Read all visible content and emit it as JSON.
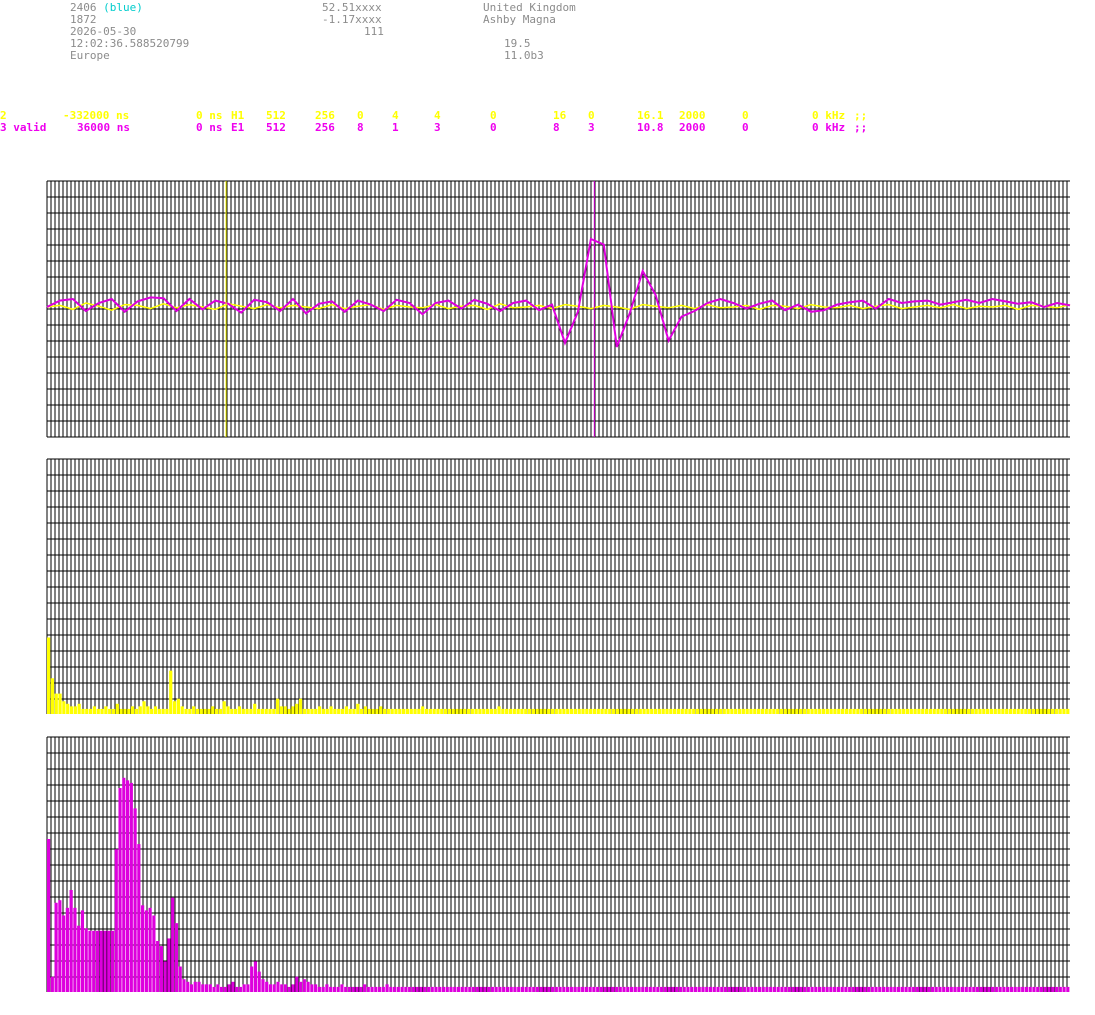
{
  "header": {
    "station_id": "2406",
    "station_color_label": "(blue)",
    "station_number": "1872",
    "date": "2026-05-30",
    "time": "12:02:36.588520799",
    "region": "Europe",
    "latitude": "52.51xxxx",
    "longitude": "-1.17xxxx",
    "altitude": "111",
    "country": "United Kingdom",
    "place": "Ashby Magna",
    "value_a": "19.5",
    "value_b": "11.0b3"
  },
  "channels": [
    {
      "color": "#ffff00",
      "fields": [
        "2",
        "-332000 ns",
        "0 ns",
        "H1",
        "512",
        "256",
        "0",
        "4",
        "4",
        "0",
        "16",
        "0",
        "16.1",
        "2000",
        "0",
        "0 kHz",
        ";;"
      ]
    },
    {
      "color": "#ee00ee",
      "fields": [
        "3 valid",
        "36000 ns",
        "0 ns",
        "E1",
        "512",
        "256",
        "8",
        "1",
        "3",
        "0",
        "8",
        "3",
        "10.8",
        "2000",
        "0",
        "0 kHz",
        ";;"
      ]
    }
  ],
  "colors": {
    "grid": "#000000",
    "background": "#ffffff",
    "yellow": "#ffff00",
    "magenta": "#dd00dd",
    "cyan": "#00cccc",
    "header_text": "#8c8c8c"
  },
  "chart_data": [
    {
      "type": "line",
      "series": [
        {
          "color": "#ffff00",
          "values": [
            0.0,
            0.02,
            -0.03,
            0.05,
            0.01,
            -0.04,
            0.03,
            0.02,
            -0.02,
            0.04,
            -0.01,
            0.03,
            0.0,
            -0.03,
            0.04,
            0.01,
            -0.02,
            0.03,
            -0.01,
            0.02,
            0.0,
            -0.02,
            0.03,
            -0.02,
            0.01,
            0.03,
            -0.03,
            0.02,
            0.0,
            -0.01,
            0.03,
            -0.02,
            0.01,
            0.02,
            -0.03,
            0.04,
            -0.01,
            0.0,
            0.02,
            -0.02,
            0.03,
            0.01,
            -0.02,
            0.02,
            0.0,
            -0.03,
            0.03,
            0.01,
            -0.01,
            0.02,
            -0.02,
            0.03,
            -0.01,
            0.0,
            0.02,
            -0.03,
            0.02,
            0.01,
            -0.02,
            0.03,
            0.0,
            -0.01,
            0.02,
            -0.02,
            0.01,
            0.03,
            -0.02,
            0.0,
            0.02,
            -0.01,
            0.03,
            -0.02,
            0.01,
            0.0,
            0.02,
            -0.03,
            0.02,
            0.01,
            -0.01,
            0.03
          ]
        },
        {
          "color": "#dd00dd",
          "values": [
            0.0,
            0.08,
            0.1,
            -0.05,
            0.05,
            0.1,
            -0.06,
            0.07,
            0.12,
            0.11,
            -0.05,
            0.1,
            -0.03,
            0.08,
            0.04,
            -0.07,
            0.09,
            0.06,
            -0.05,
            0.1,
            -0.08,
            0.04,
            0.07,
            -0.06,
            0.08,
            0.03,
            -0.05,
            0.09,
            0.05,
            -0.09,
            0.05,
            0.08,
            -0.02,
            0.09,
            0.04,
            -0.05,
            0.05,
            0.08,
            -0.04,
            0.03,
            -0.45,
            -0.06,
            0.85,
            0.78,
            -0.5,
            -0.08,
            0.45,
            0.15,
            -0.42,
            -0.12,
            -0.05,
            0.05,
            0.1,
            0.05,
            -0.02,
            0.04,
            0.08,
            -0.04,
            0.03,
            -0.06,
            -0.04,
            0.03,
            0.06,
            0.08,
            -0.02,
            0.1,
            0.05,
            0.07,
            0.08,
            0.03,
            0.06,
            0.09,
            0.05,
            0.1,
            0.07,
            0.04,
            0.06,
            0.0,
            0.05,
            0.02
          ]
        }
      ],
      "cursors": [
        {
          "color": "#ffff00",
          "position": 0.175
        },
        {
          "color": "#dd00dd",
          "position": 0.535
        }
      ]
    },
    {
      "type": "bar",
      "series": [
        {
          "color": "#ffff00",
          "values": [
            0.3,
            0.14,
            0.08,
            0.08,
            0.05,
            0.04,
            0.03,
            0.03,
            0.04,
            0.02,
            0.02,
            0.02,
            0.03,
            0.02,
            0.02,
            0.03,
            0.02,
            0.02,
            0.04,
            0.02,
            0.02,
            0.02,
            0.03,
            0.02,
            0.03,
            0.05,
            0.03,
            0.02,
            0.03,
            0.02,
            0.02,
            0.02,
            0.17,
            0.05,
            0.06,
            0.03,
            0.02,
            0.02,
            0.03,
            0.02,
            0.02,
            0.02,
            0.02,
            0.03,
            0.02,
            0.02,
            0.05,
            0.03,
            0.02,
            0.02,
            0.03,
            0.02,
            0.02,
            0.02,
            0.04,
            0.02,
            0.02,
            0.02,
            0.02,
            0.02,
            0.06,
            0.03,
            0.03,
            0.02,
            0.03,
            0.04,
            0.06,
            0.02,
            0.02,
            0.02,
            0.02,
            0.03,
            0.02,
            0.02,
            0.03,
            0.02,
            0.02,
            0.02,
            0.03,
            0.02,
            0.02,
            0.04,
            0.02,
            0.03,
            0.02,
            0.02,
            0.02,
            0.03,
            0.02,
            0.02,
            0.02,
            0.02,
            0.02,
            0.02,
            0.02,
            0.02,
            0.02,
            0.02,
            0.03,
            0.02,
            0.02,
            0.02,
            0.02,
            0.02,
            0.02,
            0.02,
            0.02,
            0.02,
            0.02,
            0.02,
            0.02,
            0.02,
            0.02,
            0.02,
            0.02,
            0.02,
            0.02,
            0.02,
            0.03,
            0.02,
            0.02,
            0.02,
            0.02,
            0.02,
            0.02,
            0.02,
            0.02,
            0.02,
            0.02,
            0.02,
            0.02,
            0.02,
            0.02,
            0.02,
            0.02,
            0.02,
            0.02,
            0.02,
            0.02,
            0.02,
            0.02,
            0.02,
            0.02,
            0.02,
            0.02,
            0.02,
            0.02,
            0.02,
            0.02,
            0.02,
            0.02,
            0.02,
            0.02,
            0.02,
            0.02,
            0.02,
            0.02,
            0.02,
            0.02,
            0.02,
            0.02,
            0.02,
            0.02,
            0.02,
            0.02,
            0.02,
            0.02,
            0.02,
            0.02,
            0.02,
            0.02,
            0.02,
            0.02,
            0.02,
            0.02,
            0.02,
            0.02,
            0.02,
            0.02,
            0.02,
            0.02,
            0.02,
            0.02,
            0.02,
            0.02,
            0.02,
            0.02,
            0.02,
            0.02,
            0.02,
            0.02,
            0.02,
            0.02,
            0.02,
            0.02,
            0.02,
            0.02,
            0.02,
            0.02,
            0.02,
            0.02,
            0.02,
            0.02,
            0.02,
            0.02,
            0.02,
            0.02,
            0.02,
            0.02,
            0.02,
            0.02,
            0.02,
            0.02,
            0.02,
            0.02,
            0.02,
            0.02,
            0.02,
            0.02,
            0.02,
            0.02,
            0.02,
            0.02,
            0.02,
            0.02,
            0.02,
            0.02,
            0.02,
            0.02,
            0.02,
            0.02,
            0.02,
            0.02,
            0.02,
            0.02,
            0.02,
            0.02,
            0.02,
            0.02,
            0.02,
            0.02,
            0.02,
            0.02,
            0.02,
            0.02,
            0.02,
            0.02,
            0.02,
            0.02,
            0.02,
            0.02,
            0.02,
            0.02,
            0.02,
            0.02,
            0.02,
            0.02,
            0.02,
            0.02,
            0.02,
            0.02,
            0.02,
            0.02,
            0.02,
            0.02,
            0.02,
            0.02,
            0.02
          ]
        }
      ]
    },
    {
      "type": "bar",
      "series": [
        {
          "color": "#dd00dd",
          "values": [
            0.6,
            0.06,
            0.35,
            0.36,
            0.3,
            0.33,
            0.4,
            0.33,
            0.26,
            0.32,
            0.25,
            0.24,
            0.24,
            0.24,
            0.24,
            0.24,
            0.24,
            0.24,
            0.56,
            0.8,
            0.84,
            0.83,
            0.82,
            0.72,
            0.58,
            0.34,
            0.32,
            0.33,
            0.3,
            0.2,
            0.18,
            0.12,
            0.21,
            0.37,
            0.27,
            0.1,
            0.05,
            0.04,
            0.03,
            0.04,
            0.04,
            0.03,
            0.03,
            0.03,
            0.02,
            0.03,
            0.02,
            0.02,
            0.03,
            0.04,
            0.02,
            0.02,
            0.03,
            0.03,
            0.1,
            0.12,
            0.08,
            0.05,
            0.04,
            0.03,
            0.03,
            0.04,
            0.03,
            0.03,
            0.02,
            0.03,
            0.06,
            0.04,
            0.05,
            0.04,
            0.03,
            0.03,
            0.02,
            0.02,
            0.03,
            0.02,
            0.02,
            0.02,
            0.03,
            0.02,
            0.02,
            0.02,
            0.02,
            0.02,
            0.03,
            0.02,
            0.02,
            0.02,
            0.02,
            0.02,
            0.03,
            0.02,
            0.02,
            0.02,
            0.02,
            0.02,
            0.02,
            0.02,
            0.02,
            0.02,
            0.02,
            0.02,
            0.02,
            0.02,
            0.02,
            0.02,
            0.02,
            0.02,
            0.02,
            0.02,
            0.02,
            0.02,
            0.02,
            0.02,
            0.02,
            0.02,
            0.02,
            0.02,
            0.02,
            0.02,
            0.02,
            0.02,
            0.02,
            0.02,
            0.02,
            0.02,
            0.02,
            0.02,
            0.02,
            0.02,
            0.02,
            0.02,
            0.02,
            0.02,
            0.02,
            0.02,
            0.02,
            0.02,
            0.02,
            0.02,
            0.02,
            0.02,
            0.02,
            0.02,
            0.02,
            0.02,
            0.02,
            0.02,
            0.02,
            0.02,
            0.02,
            0.02,
            0.02,
            0.02,
            0.02,
            0.02,
            0.02,
            0.02,
            0.02,
            0.02,
            0.02,
            0.02,
            0.02,
            0.02,
            0.02,
            0.02,
            0.02,
            0.02,
            0.02,
            0.02,
            0.02,
            0.02,
            0.02,
            0.02,
            0.02,
            0.02,
            0.02,
            0.02,
            0.02,
            0.02,
            0.02,
            0.02,
            0.02,
            0.02,
            0.02,
            0.02,
            0.02,
            0.02,
            0.02,
            0.02,
            0.02,
            0.02,
            0.02,
            0.02,
            0.02,
            0.02,
            0.02,
            0.02,
            0.02,
            0.02,
            0.02,
            0.02,
            0.02,
            0.02,
            0.02,
            0.02,
            0.02,
            0.02,
            0.02,
            0.02,
            0.02,
            0.02,
            0.02,
            0.02,
            0.02,
            0.02,
            0.02,
            0.02,
            0.02,
            0.02,
            0.02,
            0.02,
            0.02,
            0.02,
            0.02,
            0.02,
            0.02,
            0.02,
            0.02,
            0.02,
            0.02,
            0.02,
            0.02,
            0.02,
            0.02,
            0.02,
            0.02,
            0.02,
            0.02,
            0.02,
            0.02,
            0.02,
            0.02,
            0.02,
            0.02,
            0.02,
            0.02,
            0.02,
            0.02,
            0.02,
            0.02,
            0.02,
            0.02,
            0.02,
            0.02,
            0.02,
            0.02,
            0.02,
            0.02,
            0.02,
            0.02,
            0.02,
            0.02,
            0.02,
            0.02,
            0.02,
            0.02,
            0.02,
            0.02,
            0.02,
            0.02,
            0.02
          ]
        }
      ]
    }
  ]
}
